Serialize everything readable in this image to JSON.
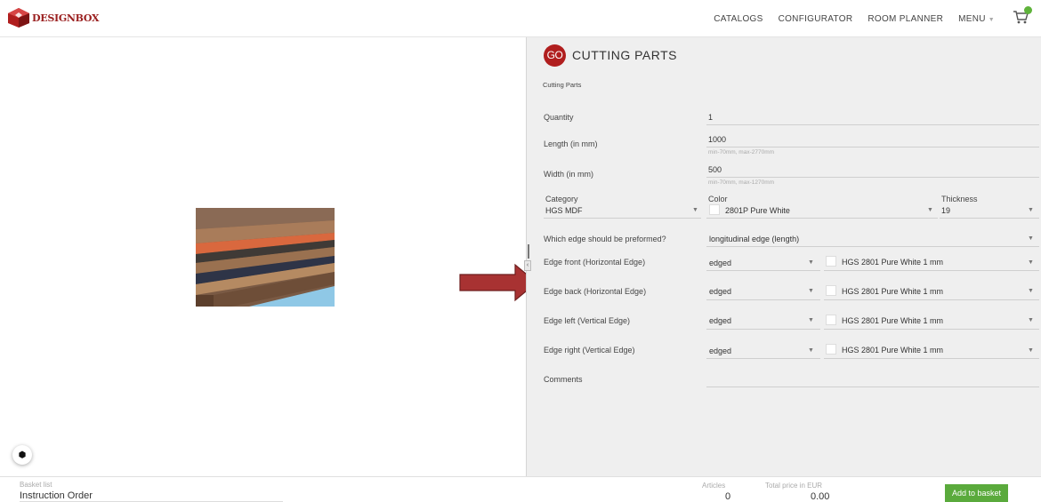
{
  "brand": {
    "logo_text": "DESIGNBOX",
    "accent_color": "#b01e1e"
  },
  "nav": {
    "items": [
      {
        "label": "CATALOGS"
      },
      {
        "label": "CONFIGURATOR"
      },
      {
        "label": "ROOM PLANNER"
      },
      {
        "label": "MENU"
      }
    ],
    "cart_icon": "cart-icon",
    "cart_badge_color": "#5fb33b"
  },
  "panel": {
    "badge": "GO",
    "title": "CUTTING PARTS",
    "subtitle": "Cutting Parts"
  },
  "form": {
    "quantity": {
      "label": "Quantity",
      "value": "1"
    },
    "length": {
      "label": "Length (in mm)",
      "value": "1000",
      "hint": "min-70mm, max-2770mm"
    },
    "width": {
      "label": "Width (in mm)",
      "value": "500",
      "hint": "min-70mm, max-1270mm"
    },
    "category": {
      "label": "Category",
      "value": "HGS MDF"
    },
    "color": {
      "label": "Color",
      "value": "2801P Pure White"
    },
    "thickness": {
      "label": "Thickness",
      "value": "19"
    },
    "preformed": {
      "label": "Which edge should be preformed?",
      "value": "longitudinal edge (length)"
    },
    "edges": [
      {
        "label": "Edge front (Horizontal Edge)",
        "type": "edged",
        "material": "HGS 2801 Pure White 1 mm"
      },
      {
        "label": "Edge back (Horizontal Edge)",
        "type": "edged",
        "material": "HGS 2801 Pure White 1 mm"
      },
      {
        "label": "Edge left (Vertical Edge)",
        "type": "edged",
        "material": "HGS 2801 Pure White 1 mm"
      },
      {
        "label": "Edge right (Vertical Edge)",
        "type": "edged",
        "material": "HGS 2801 Pure White 1 mm"
      }
    ],
    "comments": {
      "label": "Comments",
      "value": ""
    }
  },
  "footer": {
    "basket_label": "Basket list",
    "basket_name": "Instruction Order",
    "articles_label": "Articles",
    "articles_value": "0",
    "total_label": "Total price in EUR",
    "total_value": "0.00",
    "add_button": "Add to basket",
    "button_color": "#5aaa3c"
  },
  "arrow_color": "#a83232"
}
